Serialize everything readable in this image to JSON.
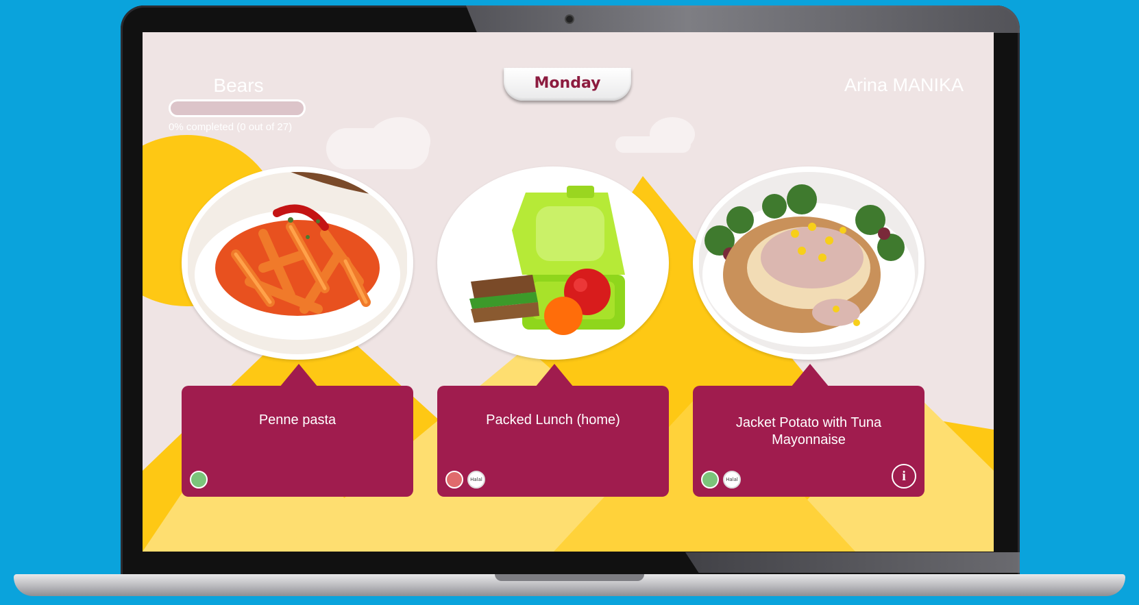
{
  "header": {
    "class_name": "Bears",
    "progress": {
      "percent": 0,
      "text": "0% completed (0 out of 27)"
    },
    "day": "Monday",
    "user_name": "Arina MANIKA"
  },
  "meals": [
    {
      "name": "Penne pasta",
      "dietary_color": "#7bc47a",
      "halal": false,
      "info": false,
      "halal_label": "Halal"
    },
    {
      "name": "Packed Lunch (home)",
      "dietary_color": "#e06a6c",
      "halal": true,
      "info": false,
      "halal_label": "Halal"
    },
    {
      "name": "Jacket Potato with Tuna Mayonnaise",
      "dietary_color": "#7bc47a",
      "halal": true,
      "info": true,
      "halal_label": "Halal"
    }
  ],
  "colors": {
    "accent": "#a01c4e",
    "background": "#efe4e4",
    "mountain": "#fec814",
    "desktop": "#0aa3dc"
  }
}
